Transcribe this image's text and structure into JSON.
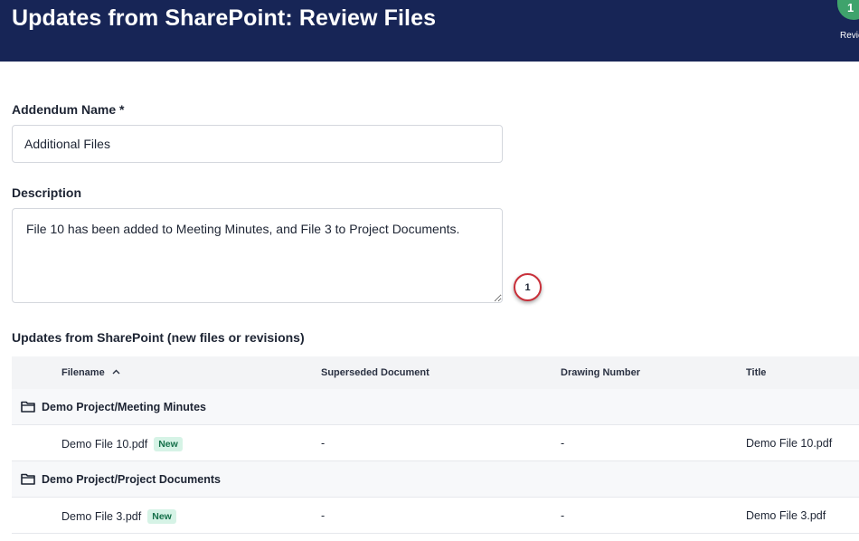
{
  "header": {
    "title": "Updates from SharePoint: Review Files",
    "step_number": "1",
    "step_label": "Review"
  },
  "form": {
    "addendum_name_label": "Addendum Name *",
    "addendum_name_value": "Additional Files",
    "description_label": "Description",
    "description_value": "File 10 has been added to Meeting Minutes, and File 3 to Project Documents.",
    "callout_number": "1"
  },
  "updates": {
    "section_title": "Updates from SharePoint (new files or revisions)",
    "columns": {
      "filename": "Filename",
      "superseded": "Superseded Document",
      "drawing_number": "Drawing Number",
      "title": "Title"
    },
    "groups": [
      {
        "folder": "Demo Project/Meeting Minutes",
        "files": [
          {
            "filename": "Demo File 10.pdf",
            "badge": "New",
            "superseded": "-",
            "drawing_number": "-",
            "title": "Demo File 10.pdf"
          }
        ]
      },
      {
        "folder": "Demo Project/Project Documents",
        "files": [
          {
            "filename": "Demo File 3.pdf",
            "badge": "New",
            "superseded": "-",
            "drawing_number": "-",
            "title": "Demo File 3.pdf"
          }
        ]
      }
    ]
  },
  "colors": {
    "header_bg": "#172556",
    "step_green": "#3fa36c",
    "badge_bg": "#d6f3e6",
    "badge_text": "#15704a",
    "callout_border": "#c9303a"
  }
}
